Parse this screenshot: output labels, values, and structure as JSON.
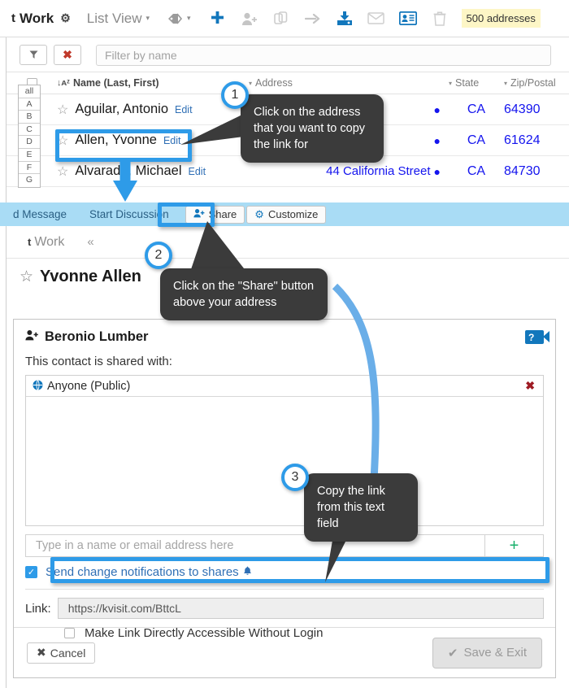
{
  "topbar": {
    "brand_logo": "t",
    "brand": "Work",
    "gear_icon": "gear-icon",
    "view_label": "List View",
    "caret": "▾",
    "tag_icon": "tag-icon",
    "icons": [
      {
        "name": "add-icon",
        "glyph": "✚",
        "state": "active"
      },
      {
        "name": "add-person-icon",
        "glyph": "👤",
        "state": "disabled"
      },
      {
        "name": "copy-icon",
        "glyph": "❐",
        "state": "disabled"
      },
      {
        "name": "move-arrow-icon",
        "glyph": "→",
        "state": "disabled"
      },
      {
        "name": "import-icon",
        "glyph": "⬇",
        "state": "active"
      },
      {
        "name": "mail-icon",
        "glyph": "✉",
        "state": "disabled"
      },
      {
        "name": "contact-card-icon",
        "glyph": "▤",
        "state": "active"
      },
      {
        "name": "trash-icon",
        "glyph": "🗑",
        "state": "disabled"
      }
    ],
    "count_badge": "500 addresses"
  },
  "filterbar": {
    "filter_icon": "▼",
    "clear_icon": "✖",
    "placeholder": "Filter by name"
  },
  "alphabet": [
    "all",
    "A",
    "B",
    "C",
    "D",
    "E",
    "F",
    "G"
  ],
  "table": {
    "headers": {
      "name": "Name (Last, First)",
      "sort_glyph": "↓ᴀᶻ",
      "address": "Address",
      "state": "State",
      "zip": "Zip/Postal"
    },
    "rows": [
      {
        "name": "Aguilar, Antonio",
        "edit": "Edit",
        "address": "",
        "state": "CA",
        "zip": "64390"
      },
      {
        "name": "Allen, Yvonne",
        "edit": "Edit",
        "address": "",
        "state": "CA",
        "zip": "61624"
      },
      {
        "name": "Alvarado, Michael",
        "edit": "Edit",
        "address": "44 California Street",
        "state": "CA",
        "zip": "84730"
      }
    ]
  },
  "actionstrip": {
    "send_message": "d Message",
    "start_discussion": "Start Discussion",
    "share": "Share",
    "customize": "Customize"
  },
  "detail": {
    "breadcrumb_logo": "t",
    "breadcrumb": "Work",
    "collapse": "«",
    "person_name": "Yvonne Allen"
  },
  "dialog": {
    "title": "Beronio Lumber",
    "help_icon": "?",
    "shared_with_label": "This contact is shared with:",
    "shares": [
      {
        "label": "Anyone (Public)",
        "icon": "globe-icon",
        "remove": "✖"
      }
    ],
    "add_placeholder": "Type in a name or email address here",
    "add_button": "+",
    "notify_label": "Send change notifications to shares",
    "notify_bell": "♦",
    "notify_checked": true,
    "link_label": "Link:",
    "link_value": "https://kvisit.com/BttcL",
    "access_label": "Make Link Directly Accessible Without Login",
    "access_checked": false,
    "cancel_button": "Cancel",
    "save_button": "Save & Exit"
  },
  "annotations": [
    {
      "number": "1",
      "text": "Click on the address that you want to copy the link for"
    },
    {
      "number": "2",
      "text": "Click on the \"Share\" button above your address"
    },
    {
      "number": "3",
      "text": "Copy the link from this text field"
    }
  ],
  "colors": {
    "highlight": "#2e9be8",
    "tooltip_bg": "#3b3b3b",
    "link_blue": "#1414ee",
    "accent_blue": "#1277bc",
    "strip_blue": "#a9dcf5",
    "badge_yellow": "#fdf6c6",
    "green_plus": "#18b06b"
  }
}
